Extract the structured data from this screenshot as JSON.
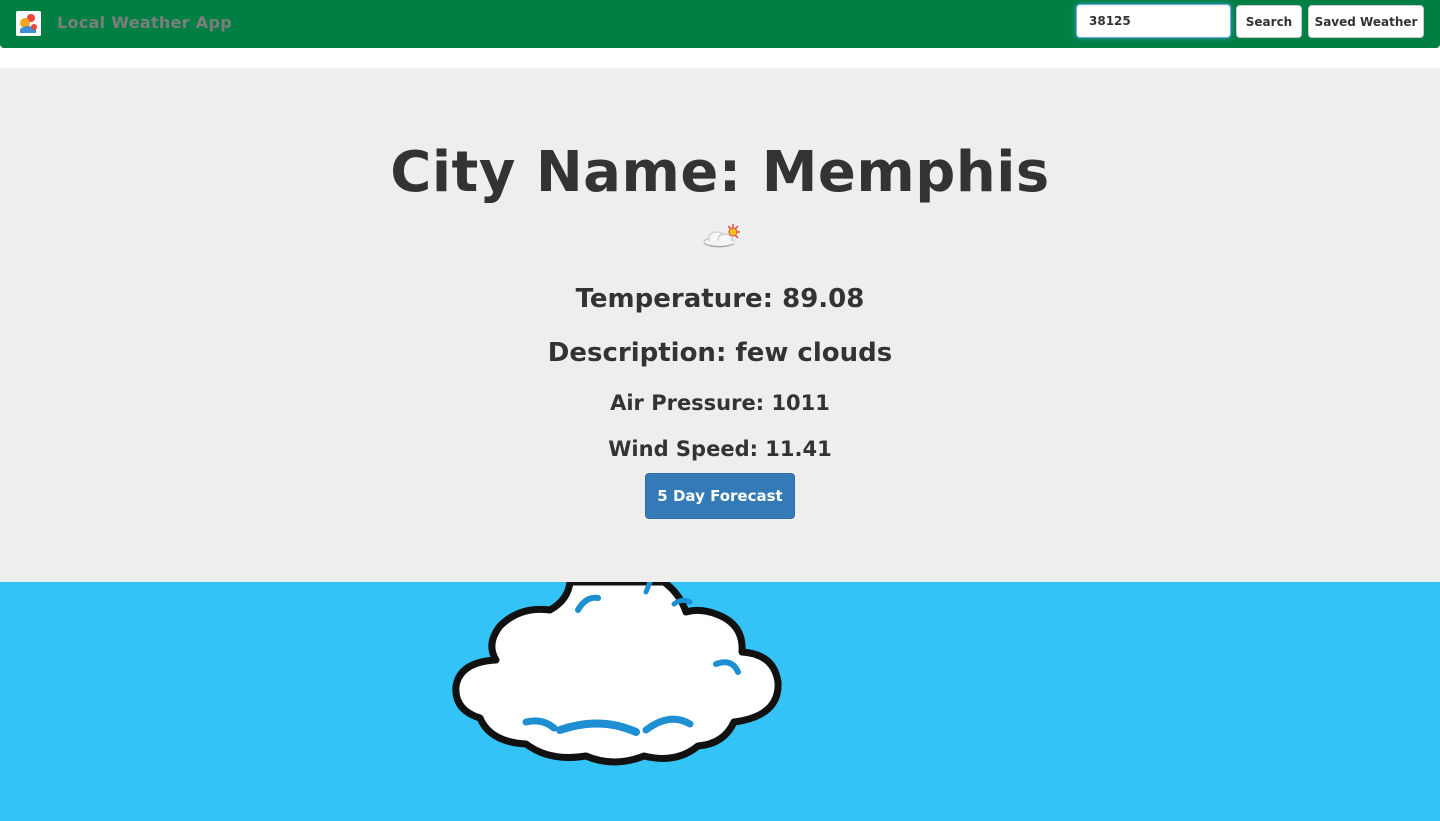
{
  "navbar": {
    "brand_title": "Local Weather App",
    "search_value": "38125",
    "search_button": "Search",
    "saved_button": "Saved Weather"
  },
  "weather": {
    "city_line": "City Name: Memphis",
    "icon": "few-clouds-icon",
    "temperature_line": "Temperature: 89.08",
    "description_line": "Description: few clouds",
    "pressure_line": "Air Pressure: 1011",
    "wind_line": "Wind Speed: 11.41",
    "forecast_button": "5 Day Forecast"
  },
  "colors": {
    "navbar": "#007f45",
    "jumbotron": "#eeeeee",
    "primary_button": "#337ab7",
    "sky": "#34c3f7"
  }
}
